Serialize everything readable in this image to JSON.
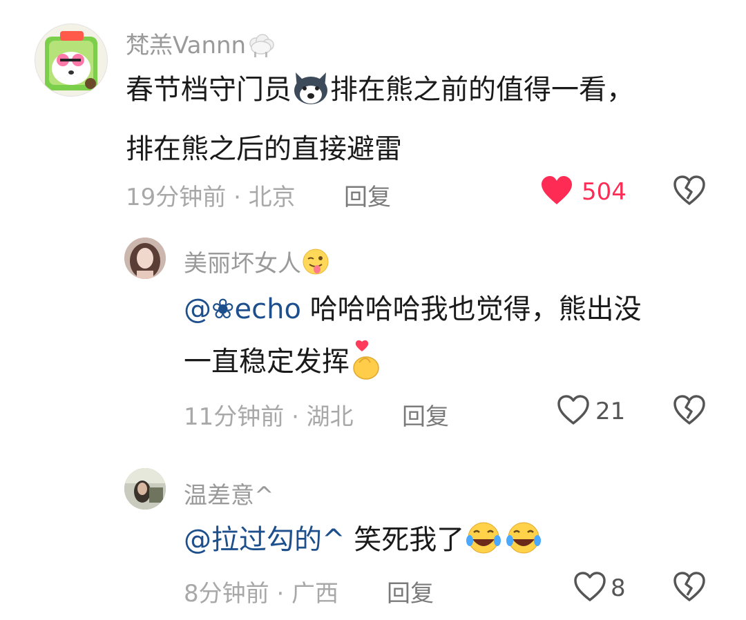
{
  "comments": [
    {
      "username": "梵羔Vannn",
      "body_line1_a": "春节档守门员",
      "body_line1_b": "排在熊之前的值得一看，",
      "body_line2": "排在熊之后的直接避雷",
      "time_location": "19分钟前 · 北京",
      "reply_label": "回复",
      "like_count": "504",
      "liked": true,
      "username_badge_icon": "sheep-icon",
      "inline_icon": "husky-dog-icon"
    },
    {
      "username": "美丽坏女人",
      "mention": "@❀echo",
      "body_line1": " 哈哈哈哈我也觉得，熊出没",
      "body_line2": "一直稳定发挥",
      "time_location": "11分钟前 · 湖北",
      "reply_label": "回复",
      "like_count": "21",
      "liked": false,
      "username_badge_icon": "tongue-wink-emoji-icon",
      "trailing_icon": "finger-heart-icon"
    },
    {
      "username": "温差意^",
      "mention": "@拉过勾的^",
      "body_line1": " 笑死我了",
      "time_location": "8分钟前 · 广西",
      "reply_label": "回复",
      "like_count": "8",
      "liked": false,
      "trailing_icon": "rofl-emoji-icon"
    }
  ],
  "colors": {
    "liked_red": "#fe2c55",
    "mention_blue": "#1d4f8c",
    "meta_gray": "#a8a8a8"
  }
}
